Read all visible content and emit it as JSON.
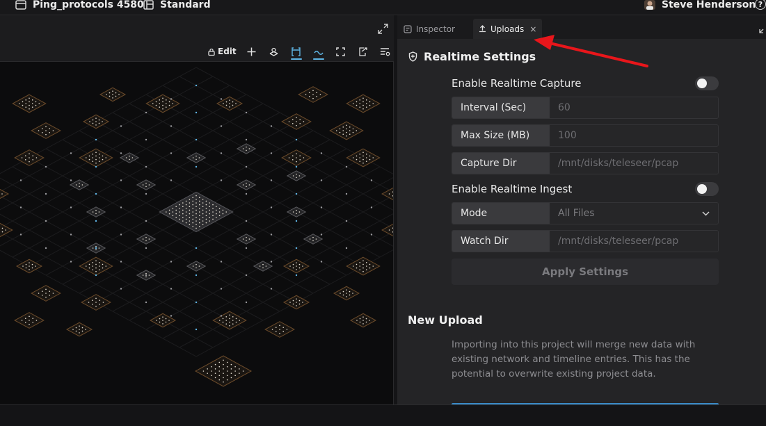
{
  "topbar": {
    "project_name": "Ping_protocols 4580",
    "layout_name": "Standard",
    "user_name": "Steve Henderson",
    "help_label": "?"
  },
  "viewport_toolbar": {
    "edit_label": "Edit"
  },
  "tabs": [
    {
      "label": "Inspector",
      "active": false
    },
    {
      "label": "Uploads",
      "active": true,
      "close": "×"
    }
  ],
  "realtime": {
    "title": "Realtime Settings",
    "capture_toggle_label": "Enable Realtime Capture",
    "capture_enabled": false,
    "fields": [
      {
        "label": "Interval (Sec)",
        "placeholder": "60"
      },
      {
        "label": "Max Size (MB)",
        "placeholder": "100"
      },
      {
        "label": "Capture Dir",
        "placeholder": "/mnt/disks/teleseer/pcap"
      }
    ],
    "ingest_toggle_label": "Enable Realtime Ingest",
    "ingest_enabled": false,
    "mode_label": "Mode",
    "mode_value": "All Files",
    "watch_label": "Watch Dir",
    "watch_placeholder": "/mnt/disks/teleseer/pcap",
    "apply_label": "Apply Settings"
  },
  "upload": {
    "title": "New Upload",
    "description": "Importing into this project will merge new data with existing network and timeline entries. This has the potential to overwrite existing project data."
  },
  "colors": {
    "accent": "#5fb6e6",
    "annotation_arrow": "#e8161b",
    "node_fill": "#2a2a2c",
    "node_border": "#6a4a2a"
  }
}
